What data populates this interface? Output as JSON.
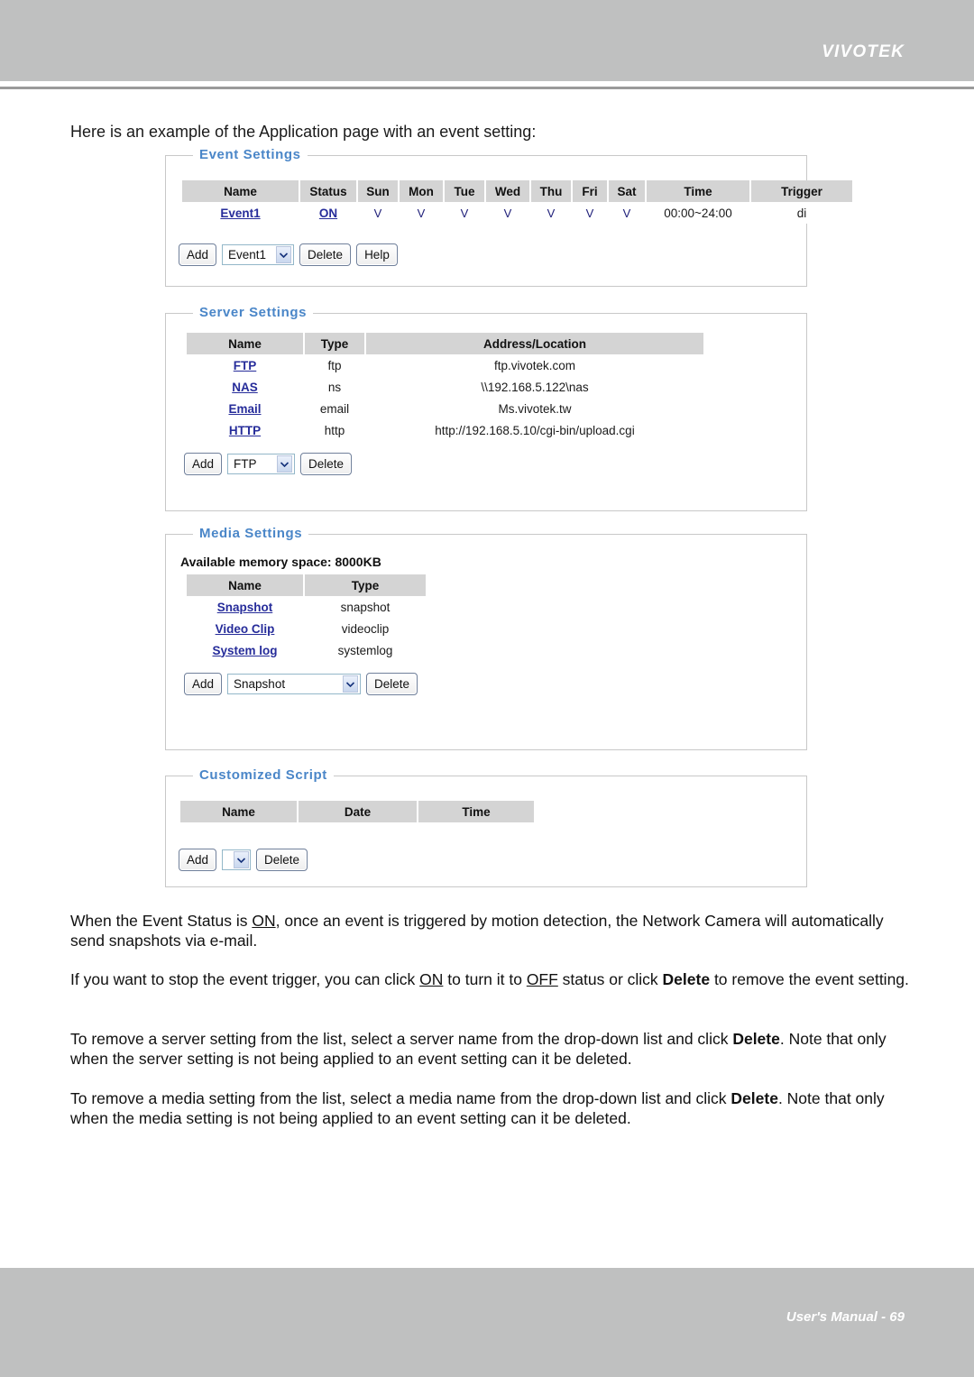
{
  "header": {
    "brand": "VIVOTEK"
  },
  "footer": {
    "text": "User's Manual - 69"
  },
  "intro": "Here is an example of the Application page with an event setting:",
  "event_settings": {
    "legend": "Event Settings",
    "columns": [
      "Name",
      "Status",
      "Sun",
      "Mon",
      "Tue",
      "Wed",
      "Thu",
      "Fri",
      "Sat",
      "Time",
      "Trigger"
    ],
    "rows": [
      {
        "name": "Event1",
        "status": "ON",
        "sun": "V",
        "mon": "V",
        "tue": "V",
        "wed": "V",
        "thu": "V",
        "fri": "V",
        "sat": "V",
        "time": "00:00~24:00",
        "trigger": "di"
      }
    ],
    "controls": {
      "add_label": "Add",
      "select_value": "Event1",
      "delete_label": "Delete",
      "help_label": "Help"
    }
  },
  "server_settings": {
    "legend": "Server Settings",
    "columns": [
      "Name",
      "Type",
      "Address/Location"
    ],
    "rows": [
      {
        "name": "FTP",
        "type": "ftp",
        "address": "ftp.vivotek.com"
      },
      {
        "name": "NAS",
        "type": "ns",
        "address": "\\\\192.168.5.122\\nas"
      },
      {
        "name": "Email",
        "type": "email",
        "address": "Ms.vivotek.tw"
      },
      {
        "name": "HTTP",
        "type": "http",
        "address": "http://192.168.5.10/cgi-bin/upload.cgi"
      }
    ],
    "controls": {
      "add_label": "Add",
      "select_value": "FTP",
      "delete_label": "Delete"
    }
  },
  "media_settings": {
    "legend": "Media Settings",
    "memory_note": "Available memory space: 8000KB",
    "columns": [
      "Name",
      "Type"
    ],
    "rows": [
      {
        "name": "Snapshot",
        "type": "snapshot"
      },
      {
        "name": "Video Clip",
        "type": "videoclip"
      },
      {
        "name": "System log",
        "type": "systemlog"
      }
    ],
    "controls": {
      "add_label": "Add",
      "select_value": "Snapshot",
      "delete_label": "Delete"
    }
  },
  "customized_script": {
    "legend": "Customized Script",
    "columns": [
      "Name",
      "Date",
      "Time"
    ],
    "rows": [],
    "controls": {
      "add_label": "Add",
      "select_value": "",
      "delete_label": "Delete"
    }
  },
  "paragraphs": {
    "p1_a": "When the Event Status is ",
    "p1_on": "ON",
    "p1_b": ", once an event is triggered by motion detection, the Network Camera will automatically send snapshots via e-mail.",
    "p2_a": "If you want to stop the event trigger, you can click ",
    "p2_on": "ON",
    "p2_b": " to turn it to ",
    "p2_off": "OFF",
    "p2_c": " status or click ",
    "p2_delete": "Delete",
    "p2_d": " to remove the event setting.",
    "p3_a": "To remove a server setting from the list, select a server name from the drop-down list and click ",
    "p3_delete": "Delete",
    "p3_b": ". Note that only when the server setting is not being applied to an event setting can it be deleted.",
    "p4_a": "To remove a media setting from the list, select a media name from the drop-down list and click ",
    "p4_delete": "Delete",
    "p4_b": ". Note that only when the media setting is not being applied to an event setting can it be deleted."
  },
  "colors": {
    "header_band": "#bfc0c0",
    "legend_blue": "#4a86c8",
    "link_blue": "#262c9a",
    "table_header_gray": "#d4d4d4"
  }
}
